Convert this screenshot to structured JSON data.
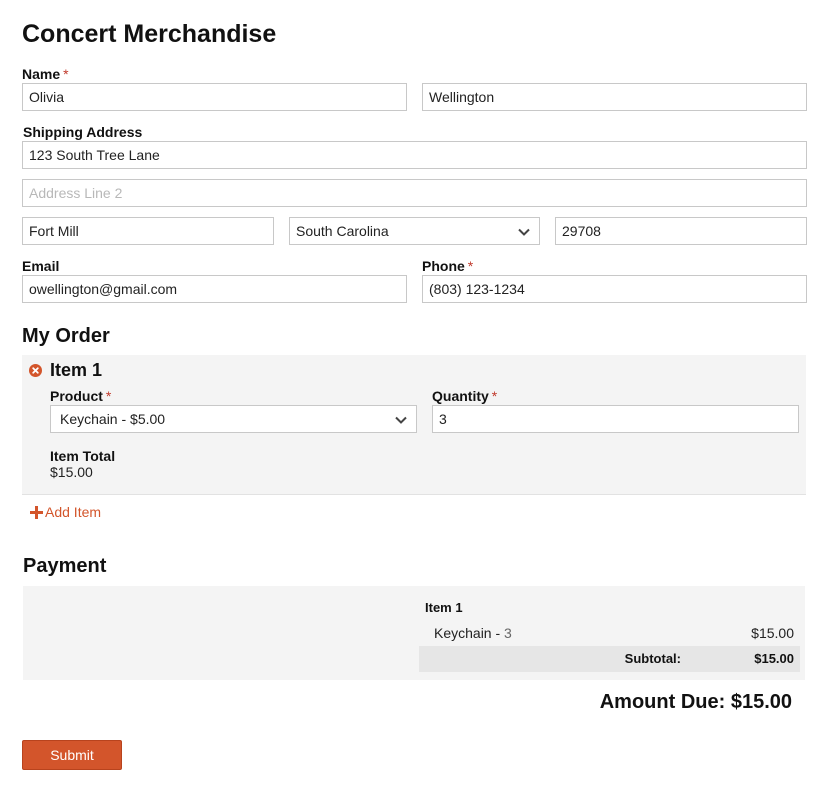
{
  "form": {
    "title": "Concert Merchandise",
    "name": {
      "label": "Name",
      "required_mark": "*",
      "first": "Olivia",
      "last": "Wellington"
    },
    "shipping": {
      "label": "Shipping Address",
      "line1": "123 South Tree Lane",
      "line2_placeholder": "Address Line 2",
      "city": "Fort Mill",
      "state": "South Carolina",
      "zip": "29708"
    },
    "email": {
      "label": "Email",
      "value": "owellington@gmail.com"
    },
    "phone": {
      "label": "Phone",
      "required_mark": "*",
      "value": "(803) 123-1234"
    }
  },
  "order": {
    "title": "My Order",
    "item": {
      "title": "Item 1",
      "product_label": "Product",
      "product_required": "*",
      "product_value": "Keychain - $5.00",
      "quantity_label": "Quantity",
      "quantity_required": "*",
      "quantity_value": "3",
      "total_label": "Item Total",
      "total_value": "$15.00"
    },
    "add_item_label": "Add Item"
  },
  "payment": {
    "title": "Payment",
    "summary_item_title": "Item 1",
    "line_name": "Keychain - ",
    "line_qty": "3",
    "line_price": "$15.00",
    "subtotal_label": "Subtotal:",
    "subtotal_value": "$15.00",
    "amount_due": "Amount Due: $15.00"
  },
  "submit_label": "Submit",
  "colors": {
    "accent": "#d3552b",
    "panel": "#f4f4f4",
    "required": "#c0392b"
  },
  "icons": {
    "remove": "remove-item-icon",
    "add": "plus-icon",
    "select": "chevron-down-icon"
  }
}
